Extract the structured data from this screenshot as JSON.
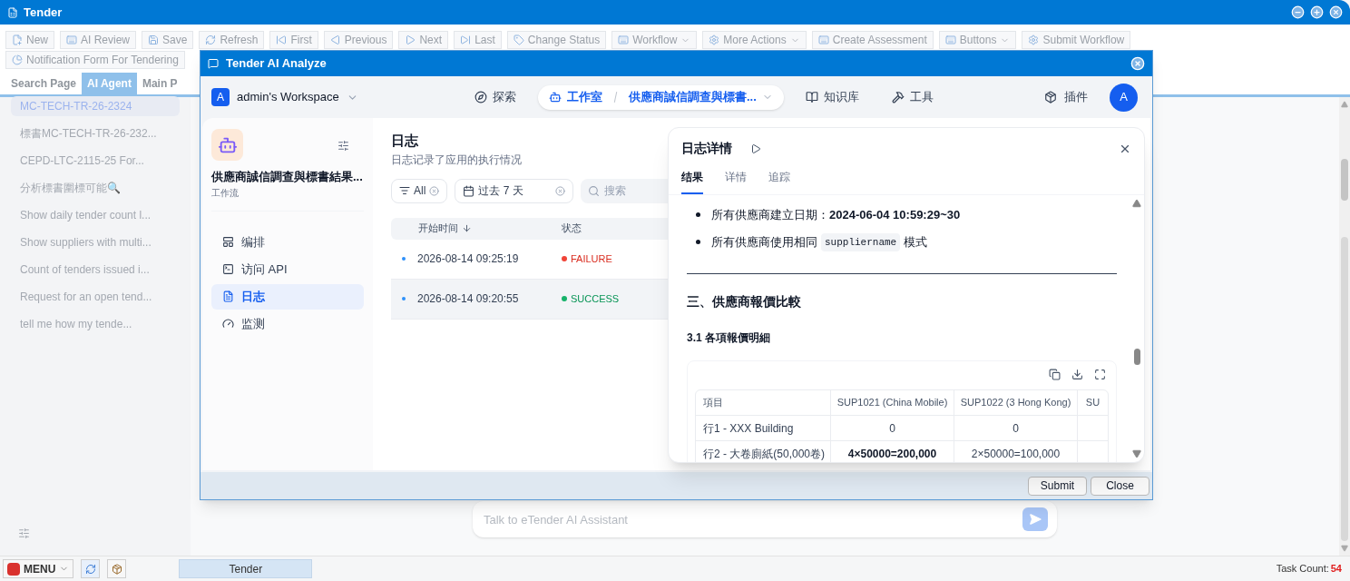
{
  "window": {
    "title": "Tender"
  },
  "toolbar": [
    {
      "label": "New",
      "kind": "button"
    },
    {
      "label": "AI Review",
      "kind": "button"
    },
    {
      "label": "Save",
      "kind": "button"
    },
    {
      "label": "Refresh",
      "kind": "button"
    },
    {
      "label": "First",
      "kind": "button"
    },
    {
      "label": "Previous",
      "kind": "button"
    },
    {
      "label": "Next",
      "kind": "button"
    },
    {
      "label": "Last",
      "kind": "button"
    },
    {
      "label": "Change Status",
      "kind": "button"
    },
    {
      "label": "Workflow",
      "kind": "dropdown"
    },
    {
      "label": "More Actions",
      "kind": "dropdown"
    },
    {
      "label": "Create Assessment",
      "kind": "button"
    },
    {
      "label": "Buttons",
      "kind": "dropdown"
    },
    {
      "label": "Submit Workflow",
      "kind": "button"
    }
  ],
  "toolbar_row2": [
    {
      "label": "Notification Form For Tendering",
      "kind": "button"
    }
  ],
  "tabs": [
    {
      "label": "Search Page",
      "selected": false
    },
    {
      "label": "AI Agent",
      "selected": true
    },
    {
      "label": "Main P",
      "selected": false
    }
  ],
  "sidebar": {
    "items": [
      {
        "label": "MC-TECH-TR-26-2324",
        "selected": true
      },
      {
        "label": "標書MC-TECH-TR-26-232...",
        "selected": false
      },
      {
        "label": "CEPD-LTC-2115-25 For...",
        "selected": false
      },
      {
        "label": "分析標書圍標可能🔍",
        "selected": false
      },
      {
        "label": "Show daily tender count l...",
        "selected": false
      },
      {
        "label": "Show suppliers with multi...",
        "selected": false
      },
      {
        "label": "Count of tenders issued i...",
        "selected": false
      },
      {
        "label": "Request for an open tend...",
        "selected": false
      },
      {
        "label": "tell me how my tende...",
        "selected": false
      }
    ]
  },
  "chat": {
    "placeholder": "Talk to eTender AI Assistant"
  },
  "dialog": {
    "title": "Tender AI Analyze",
    "workspace": {
      "avatar": "A",
      "name": "admin's Workspace"
    },
    "nav": [
      {
        "label": "探索",
        "selected": false
      },
      {
        "label": "工作室",
        "selected": true,
        "breadcrumb": "供應商誠信調查與標書..."
      },
      {
        "label": "知识库",
        "selected": false
      },
      {
        "label": "工具",
        "selected": false
      }
    ],
    "plugins": "插件",
    "user_avatar": "A",
    "app": {
      "name": "供應商誠信調查與標書結果...",
      "type": "工作流"
    },
    "menu": [
      {
        "label": "编排",
        "selected": false
      },
      {
        "label": "访问 API",
        "selected": false
      },
      {
        "label": "日志",
        "selected": true
      },
      {
        "label": "监测",
        "selected": false
      }
    ],
    "logs": {
      "title": "日志",
      "subtitle": "日志记录了应用的执行情况",
      "filter": "All",
      "date_range": "过去 7 天",
      "search": {
        "placeholder": "搜索"
      },
      "columns": [
        {
          "label": "开始时间",
          "sorted": true
        },
        {
          "label": "状态",
          "sorted": false
        }
      ],
      "rows": [
        {
          "time": "2026-08-14 09:25:19",
          "status": "FAILURE",
          "kind": "failure",
          "selected": false
        },
        {
          "time": "2026-08-14 09:20:55",
          "status": "SUCCESS",
          "kind": "success",
          "selected": true
        }
      ]
    },
    "detail": {
      "title": "日志详情",
      "tabs": [
        {
          "label": "结果",
          "selected": true
        },
        {
          "label": "详情",
          "selected": false
        },
        {
          "label": "追踪",
          "selected": false
        }
      ],
      "bullets": [
        [
          {
            "kind": "text",
            "text": "所有供應商建立日期：**2024-06-04 10:59:29~30**"
          }
        ],
        [
          {
            "kind": "text",
            "text": "所有供應商使用相同"
          },
          {
            "kind": "code",
            "text": "suppliername"
          },
          {
            "kind": "text",
            "text": "模式"
          }
        ]
      ],
      "heading": "三、供應商報價比較",
      "subheading": "3.1 各項報價明細",
      "table": {
        "columns": [
          "項目",
          "SUP1021 (China Mobile)",
          "SUP1022 (3 Hong Kong)",
          "SU"
        ],
        "rows": [
          [
            {
              "text": "行1 - XXX Building",
              "bold": false
            },
            {
              "text": "0",
              "bold": false
            },
            {
              "text": "0",
              "bold": false
            }
          ],
          [
            {
              "text": "行2 - 大卷廁紙(50,000卷)",
              "bold": false
            },
            {
              "text": "4×50000=200,000",
              "bold": true
            },
            {
              "text": "2×50000=100,000",
              "bold": false
            }
          ]
        ]
      }
    },
    "buttons": [
      "Submit",
      "Close"
    ]
  },
  "taskbar": {
    "menu": "MENU",
    "tasks": [
      {
        "label": "Tender",
        "selected": true
      }
    ],
    "task_count_label": "Task Count:",
    "task_count": "54"
  }
}
